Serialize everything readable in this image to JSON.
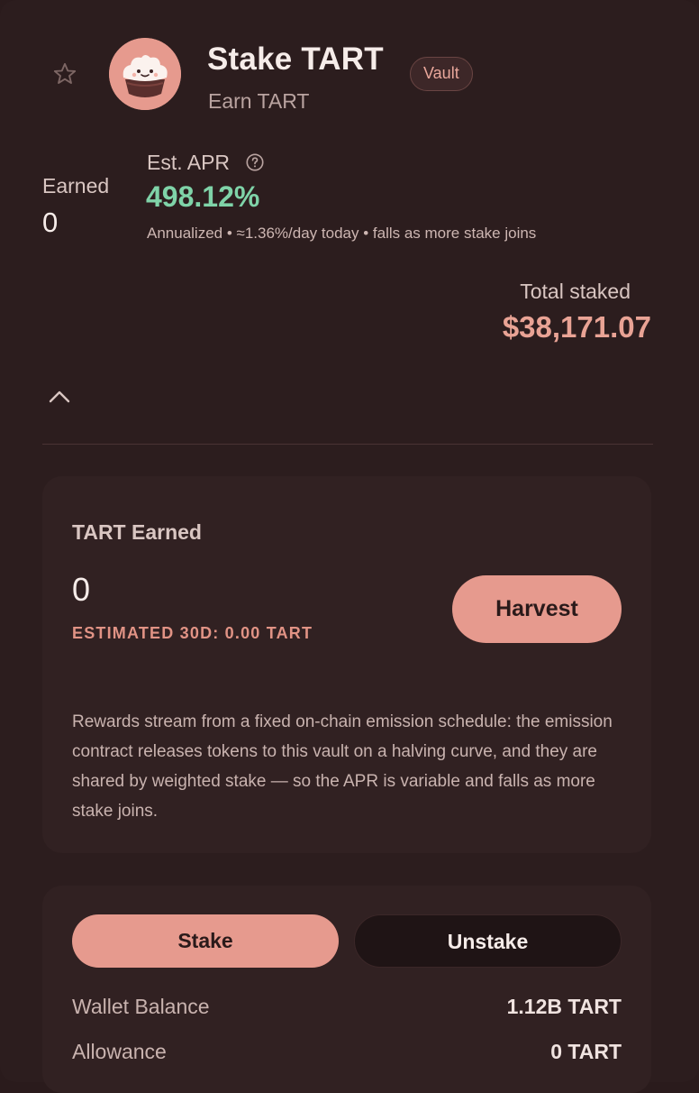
{
  "header": {
    "title": "Stake TART",
    "subtitle": "Earn TART",
    "badge": "Vault"
  },
  "stats": {
    "earned_label": "Earned",
    "earned_value": "0",
    "apr_label": "Est. APR",
    "apr_value": "498.12%",
    "apr_note": "Annualized • ≈1.36%/day today • falls as more stake joins",
    "total_label": "Total staked",
    "total_value": "$38,171.07"
  },
  "earn_panel": {
    "title": "TART Earned",
    "value": "0",
    "estimate": "ESTIMATED 30D: 0.00 TART",
    "harvest_label": "Harvest",
    "description": "Rewards stream from a fixed on-chain emission schedule: the emission contract releases tokens to this vault on a halving curve, and they are shared by weighted stake — so the APR is variable and falls as more stake joins."
  },
  "stake_panel": {
    "tabs": [
      {
        "label": "Stake"
      },
      {
        "label": "Unstake"
      }
    ],
    "rows": [
      {
        "label": "Wallet Balance",
        "value": "1.12B TART"
      },
      {
        "label": "Allowance",
        "value": "0 TART"
      }
    ]
  },
  "colors": {
    "background": "#2c1d1e",
    "accent": "#e69a8e",
    "apr_green": "#7fd3a8",
    "total_value": "#e9a395"
  },
  "icons": [
    "star-icon",
    "tart-token-icon",
    "help-circle-icon",
    "chevron-up-icon"
  ]
}
